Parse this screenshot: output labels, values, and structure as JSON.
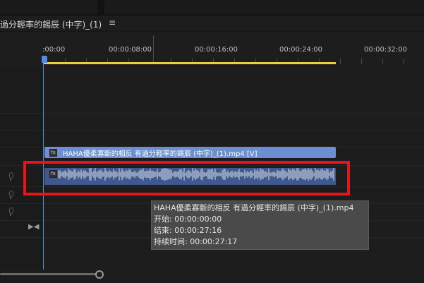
{
  "sequence": {
    "title": "過分輕率的錫辰 (中字)_(1)",
    "menu_icon": "hamburger-icon"
  },
  "ruler": {
    "ticks": [
      ":00:00",
      "00:00:08:00",
      "00:00:16:00",
      "00:00:24:00",
      "00:00:32:00"
    ]
  },
  "video_clip": {
    "name": "HAHA優柔寡斷的相反 有過分輕率的錫辰 (中字)_(1).mp4 [V]",
    "fx_label": "fx"
  },
  "audio_clip": {
    "fx_label": "fx"
  },
  "tooltip": {
    "filename": "HAHA優柔寡斷的相反 有過分輕率的錫辰 (中字)_(1).mp4",
    "start": "开始: 00:00:00:00",
    "end": "结束: 00:00:27:16",
    "duration": "持续时间: 00:00:27:17"
  },
  "colors": {
    "video_clip": "#6b8fd0",
    "audio_clip": "#3f5a8a",
    "playhead": "#4a8fe0",
    "work_area": "#e6d23a",
    "highlight": "#e8141a"
  },
  "icons": [
    "mic-icon",
    "bowtie-icon",
    "fx-icon",
    "hamburger-icon"
  ]
}
